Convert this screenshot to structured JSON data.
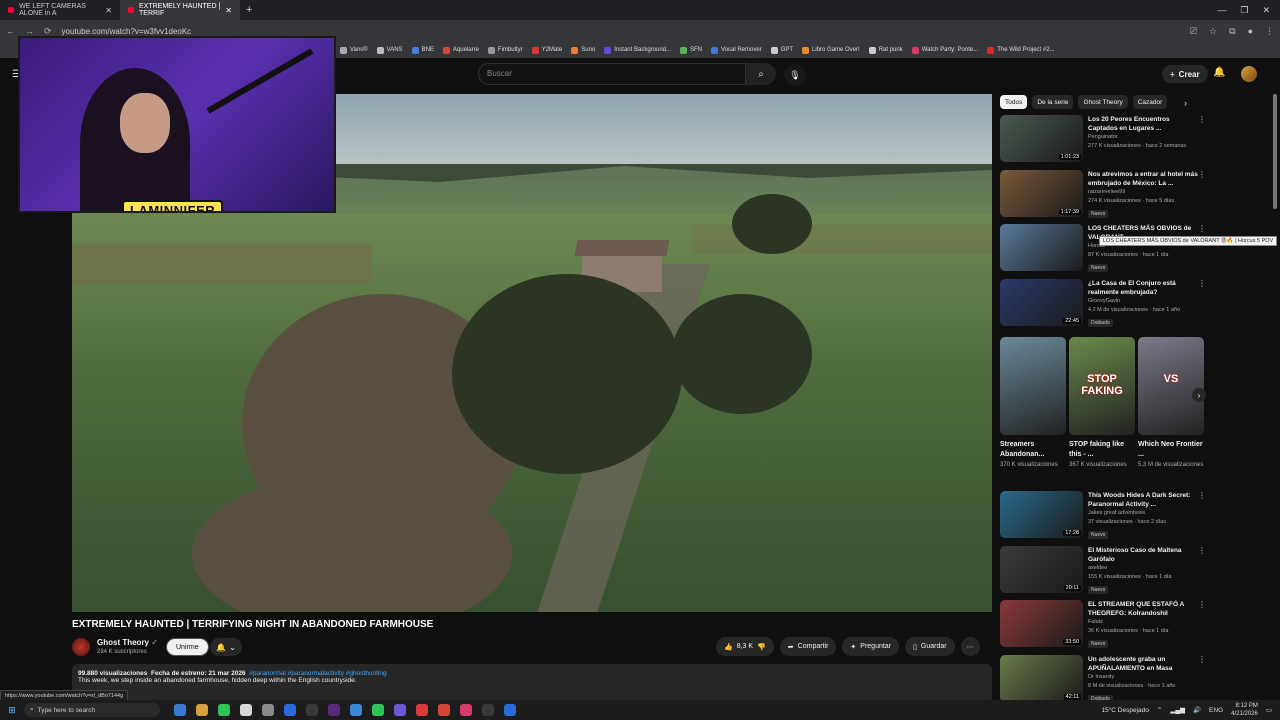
{
  "browser": {
    "tabs": [
      {
        "label": "WE LEFT CAMERAS ALONE in A",
        "active": false
      },
      {
        "label": "EXTREMELY HAUNTED | TERRIF",
        "active": true
      }
    ],
    "url": "youtube.com/watch?v=w3fvv1deoKc",
    "bookmarks": [
      {
        "label": "Vans®",
        "color": "#aaaaaa"
      },
      {
        "label": "VANS",
        "color": "#bbbbbb"
      },
      {
        "label": "BNE",
        "color": "#4a7fd8"
      },
      {
        "label": "Aquelarre",
        "color": "#d8463a"
      },
      {
        "label": "Fimbultyr",
        "color": "#999999"
      },
      {
        "label": "Y2Mate",
        "color": "#d83a3a"
      },
      {
        "label": "Suno",
        "color": "#f07a2e"
      },
      {
        "label": "Instant Background...",
        "color": "#6a4ad8"
      },
      {
        "label": "SFN",
        "color": "#5bb45b"
      },
      {
        "label": "Vocal Remover",
        "color": "#3a7ad8"
      },
      {
        "label": "GPT",
        "color": "#cccccc"
      },
      {
        "label": "Libro Game Over!",
        "color": "#e88a2e"
      },
      {
        "label": "Rat punk",
        "color": "#cccccc"
      },
      {
        "label": "Watch Party: Ponte...",
        "color": "#d83a6a"
      },
      {
        "label": "The Wild Project #2...",
        "color": "#d82a2a"
      }
    ]
  },
  "header": {
    "search_placeholder": "Buscar",
    "create_label": "Crear"
  },
  "webcam": {
    "name_tag": "LAMINNIFER"
  },
  "video": {
    "title": "EXTREMELY HAUNTED | TERRIFYING NIGHT IN ABANDONED FARMHOUSE",
    "channel": "Ghost Theory",
    "subscribers": "284 K suscriptores",
    "join_label": "Unirme",
    "likes": "8,3 K",
    "share_label": "Compartir",
    "ask_label": "Preguntar",
    "save_label": "Guardar",
    "views": "99.880 visualizaciones",
    "premiere": "Fecha de estreno: 21 mar 2026",
    "tags": "#paranormal #paranormalactivity #ghosthunting",
    "description": "This week, we step inside an abandoned farmhouse, hidden deep within the English countryside.",
    "status_url": "https://www.youtube.com/watch?v=xl_dBo7144g"
  },
  "chips": [
    "Todos",
    "De la serie",
    "Ghost Theory",
    "Cazador"
  ],
  "recommendations": [
    {
      "title": "Los 20 Peores Encuentros Captados en Lugares ...",
      "channel": "Penguinator",
      "meta": "277 K visualizaciones · hace 2 semanas",
      "duration": "1:01:23",
      "badge": "",
      "color": "#4a5a50"
    },
    {
      "title": "Nos atrevimos a entrar al hotel más embrujado de México: La ...",
      "channel": "raizareveliee99",
      "meta": "274 K visualizaciones · hace 5 días",
      "duration": "1:17:39",
      "badge": "Nuevo",
      "color": "#7a5a3a"
    },
    {
      "title": "LOS CHEATERS MÁS OBVIOS de VALORANT",
      "channel": "Horcus",
      "meta": "87 K visualizaciones · hace 1 día",
      "duration": "",
      "badge": "Nuevo",
      "color": "#5a7a9a"
    },
    {
      "title": "¿La Casa de El Conjuro está realmente embrujada?",
      "channel": "GroovyGavin",
      "meta": "4,2 M de visualizaciones · hace 1 año",
      "duration": "22:45",
      "badge": "Doblado",
      "color": "#2a3a6a"
    }
  ],
  "tooltip": "LOS CHEATERS MÁS OBVIOS de VALORANT 😡🔥 | Horcus 5 POV",
  "shorts": [
    {
      "title": "Streamers Abandonan...",
      "views": "370 K visualizaciones",
      "color": "#6a8a9a",
      "thumb_text": ""
    },
    {
      "title": "STOP faking like this - ...",
      "views": "367 K visualizaciones",
      "color": "#6a8a4a",
      "thumb_text": "STOP FAKING"
    },
    {
      "title": "Which Neo Frontier ...",
      "views": "5,3 M de visualizaciones",
      "color": "#7a7a8a",
      "thumb_text": "VS"
    }
  ],
  "recommendations2": [
    {
      "title": "This Woods Hides A Dark Secret: Paranormal Activity ...",
      "channel": "Jakes great adventures",
      "meta": "37 visualizaciones · hace 2 días",
      "duration": "17:28",
      "badge": "Nuevo",
      "color": "#2a6a8a"
    },
    {
      "title": "El Misterioso Caso de Maltena Garófalo",
      "channel": "axeldee",
      "meta": "155 K visualizaciones · hace 1 día",
      "duration": "20:11",
      "badge": "Nuevo",
      "color": "#3a3a3a"
    },
    {
      "title": "EL STREAMER QUE ESTAFÓ A THEGREFG: Kolrandoshil",
      "channel": "Fulutz",
      "meta": "36 K visualizaciones · hace 1 día",
      "duration": "33:50",
      "badge": "Nuevo",
      "color": "#8a3a3a"
    },
    {
      "title": "Un adolescente graba un APUÑALAMIENTO en Masa",
      "channel": "Dr Insanity",
      "meta": "8 M de visualizaciones · hace 1 año",
      "duration": "42:11",
      "badge": "Doblado",
      "color": "#6a7a4a"
    }
  ],
  "taskbar": {
    "search_placeholder": "Type here to search",
    "weather": "15°C  Despejado",
    "lang": "ENG",
    "time": "8:12 PM",
    "date": "4/21/2026"
  }
}
